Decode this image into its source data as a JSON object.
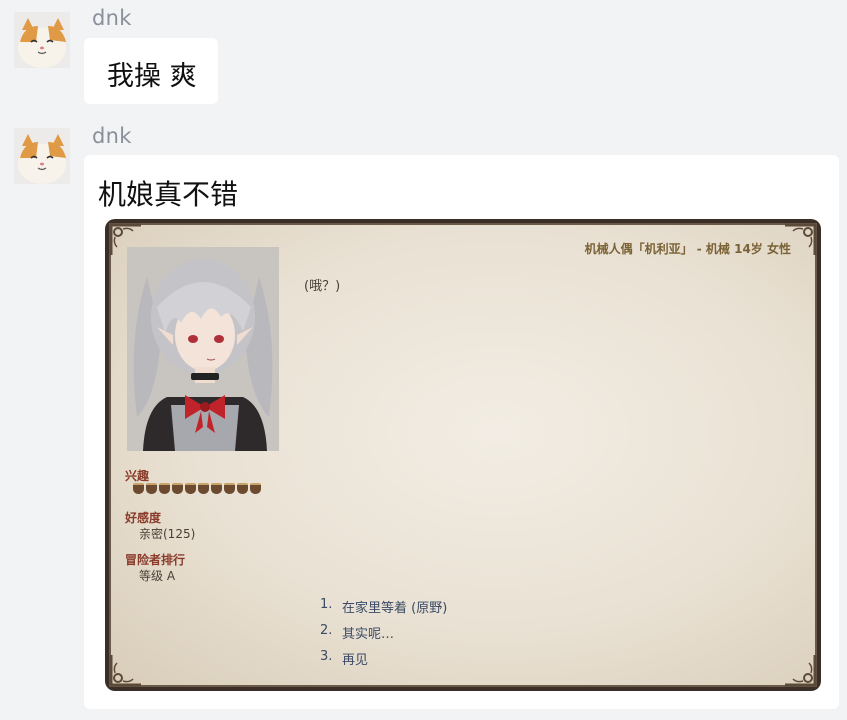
{
  "messages": [
    {
      "sender": "dnk",
      "text": "我操 爽"
    },
    {
      "sender": "dnk",
      "text": "机娘真不错",
      "image": {
        "header": "机械人偶「机利亚」 - 机械 14岁 女性",
        "dialog": "(哦？)",
        "stats": {
          "interest_label": "兴趣",
          "interest_level": 10,
          "affection_label": "好感度",
          "affection_value": "亲密(125)",
          "rank_label": "冒险者排行",
          "rank_value": "等级 A"
        },
        "options": [
          {
            "num": "1.",
            "text": "在家里等着 (原野)"
          },
          {
            "num": "2.",
            "text": "其实呢…"
          },
          {
            "num": "3.",
            "text": "再见"
          }
        ]
      }
    }
  ],
  "colors": {
    "background": "#f2f3f5",
    "bubble": "#ffffff",
    "sender": "#8a8f99",
    "option_text": "#3b4a66",
    "stat_label": "#8a3b2a"
  }
}
